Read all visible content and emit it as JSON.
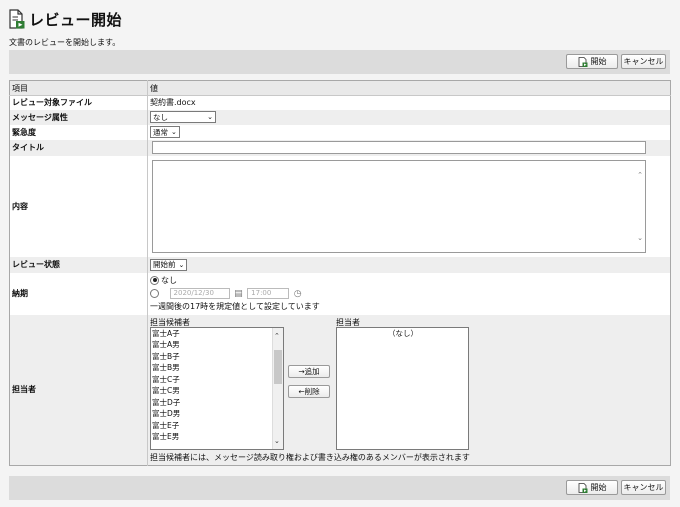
{
  "page": {
    "title": "レビュー開始",
    "subtitle": "文書のレビューを開始します。"
  },
  "toolbar": {
    "start_label": "開始",
    "cancel_label": "キャンセル"
  },
  "table": {
    "header_item": "項目",
    "header_value": "値"
  },
  "fields": {
    "target_file": {
      "label": "レビュー対象ファイル",
      "value": "契約書.docx"
    },
    "message_attr": {
      "label": "メッセージ属性",
      "value": "なし"
    },
    "urgency": {
      "label": "緊急度",
      "value": "通常"
    },
    "title_field": {
      "label": "タイトル",
      "value": ""
    },
    "content": {
      "label": "内容",
      "value": ""
    },
    "review_status": {
      "label": "レビュー状態",
      "value": "開始前"
    },
    "deadline": {
      "label": "納期",
      "option_none": "なし",
      "date_placeholder": "2020/12/30",
      "time_placeholder": "17:00",
      "note": "一週間後の17時を規定値として設定しています"
    },
    "assignee": {
      "label": "担当者",
      "candidates_label": "担当候補者",
      "assigned_label": "担当者",
      "candidates": [
        "富士A子",
        "富士A男",
        "富士B子",
        "富士B男",
        "富士C子",
        "富士C男",
        "富士D子",
        "富士D男",
        "富士E子",
        "富士E男"
      ],
      "assigned_empty": "（なし）",
      "add_label": "→追加",
      "remove_label": "←削除",
      "note": "担当候補者には、メッセージ読み取り権および書き込み権のあるメンバーが表示されます"
    }
  }
}
